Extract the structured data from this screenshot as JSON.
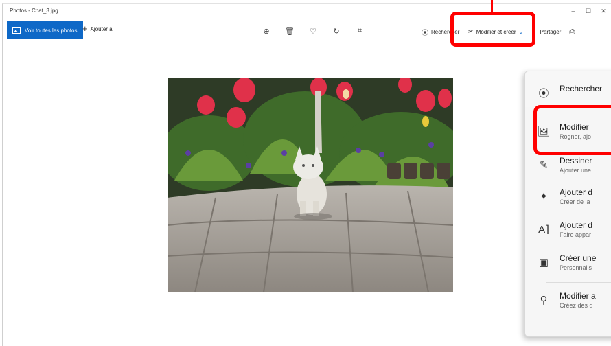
{
  "window": {
    "title": "Photos - Chat_3.jpg"
  },
  "window_controls": {
    "minimize": "–",
    "maximize": "☐",
    "close": "✕"
  },
  "toolbar": {
    "see_all_label": "Voir toutes les photos",
    "add_to_label": "Ajouter à",
    "search_label": "Rechercher",
    "edit_create_label": "Modifier et créer",
    "share_label": "Partager",
    "more_label": "···"
  },
  "center_tools": [
    {
      "name": "zoom-in-icon",
      "glyph": "⊕"
    },
    {
      "name": "delete-icon",
      "glyph": "🗑"
    },
    {
      "name": "favorite-icon",
      "glyph": "♡"
    },
    {
      "name": "rotate-icon",
      "glyph": "↻"
    },
    {
      "name": "crop-icon",
      "glyph": "⌗"
    }
  ],
  "menu": {
    "search": {
      "title": "Rechercher"
    },
    "items": [
      {
        "title": "Modifier",
        "subtitle": "Rogner, ajo"
      },
      {
        "title": "Dessiner",
        "subtitle": "Ajouter une"
      },
      {
        "title": "Ajouter d",
        "subtitle": "Créer de la"
      },
      {
        "title": "Ajouter d",
        "subtitle": "Faire appar"
      },
      {
        "title": "Créer une",
        "subtitle": "Personnalis"
      },
      {
        "title": "Modifier a",
        "subtitle": "Créez des d"
      }
    ]
  },
  "colors": {
    "accent": "#0e68c7",
    "highlight": "#ff0000"
  }
}
